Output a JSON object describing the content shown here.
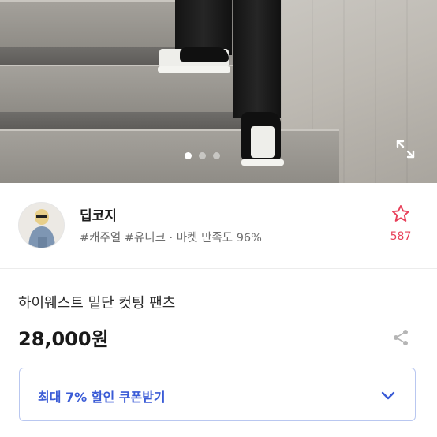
{
  "carousel": {
    "total": 3,
    "active_index": 0
  },
  "icons": {
    "expand": "expand-icon",
    "favorite": "star-outline-icon",
    "share": "share-icon",
    "dropdown": "chevron-down-icon"
  },
  "seller": {
    "name": "딥코지",
    "tags": "#캐주얼 #유니크 · 마켓 만족도 96%",
    "favorite_count": "587"
  },
  "product": {
    "title": "하이웨스트 밑단 컷팅 팬츠",
    "price": "28,000원"
  },
  "coupon": {
    "label": "최대 7% 할인 쿠폰받기"
  },
  "colors": {
    "favorite_accent": "#e8405a",
    "coupon_text": "#3a5bd6",
    "coupon_border": "#b9c7f0",
    "tags_text": "#6e6e6e"
  }
}
